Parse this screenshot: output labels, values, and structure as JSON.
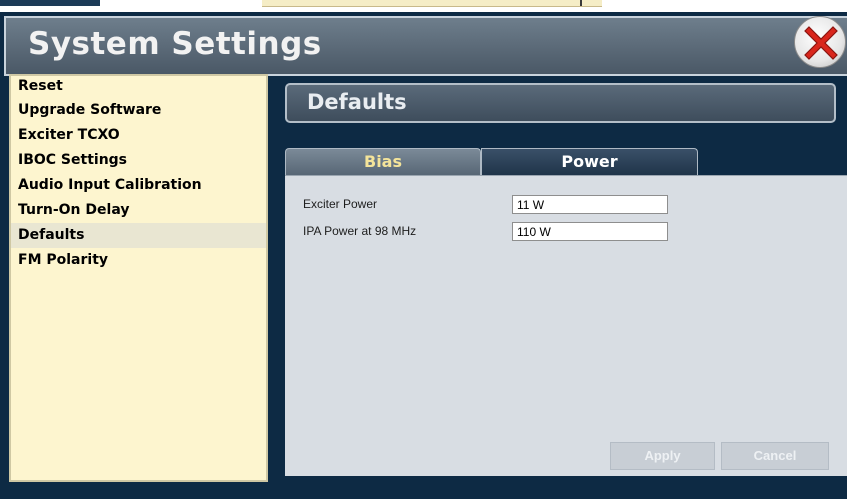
{
  "window": {
    "title": "System Settings"
  },
  "menu": {
    "items": [
      {
        "label": "Reset"
      },
      {
        "label": "Upgrade Software"
      },
      {
        "label": "Exciter TCXO"
      },
      {
        "label": "IBOC Settings"
      },
      {
        "label": "Audio Input Calibration"
      },
      {
        "label": "Turn-On Delay"
      },
      {
        "label": "Defaults",
        "selected": true
      },
      {
        "label": "FM Polarity"
      }
    ]
  },
  "panel": {
    "title": "Defaults",
    "tabs": [
      {
        "label": "Bias",
        "active": false
      },
      {
        "label": "Power",
        "active": true
      }
    ],
    "fields": [
      {
        "label": "Exciter Power",
        "value": "11 W"
      },
      {
        "label": "IPA Power at 98 MHz",
        "value": "110 W"
      }
    ],
    "buttons": {
      "apply": "Apply",
      "cancel": "Cancel"
    }
  },
  "icons": {
    "close": "close-icon"
  },
  "colors": {
    "menu_bg": "#fdf5cf",
    "header_bg": "#5d6c7a",
    "close_red": "#d9261c",
    "bias_tab_text": "#f4e49a"
  }
}
